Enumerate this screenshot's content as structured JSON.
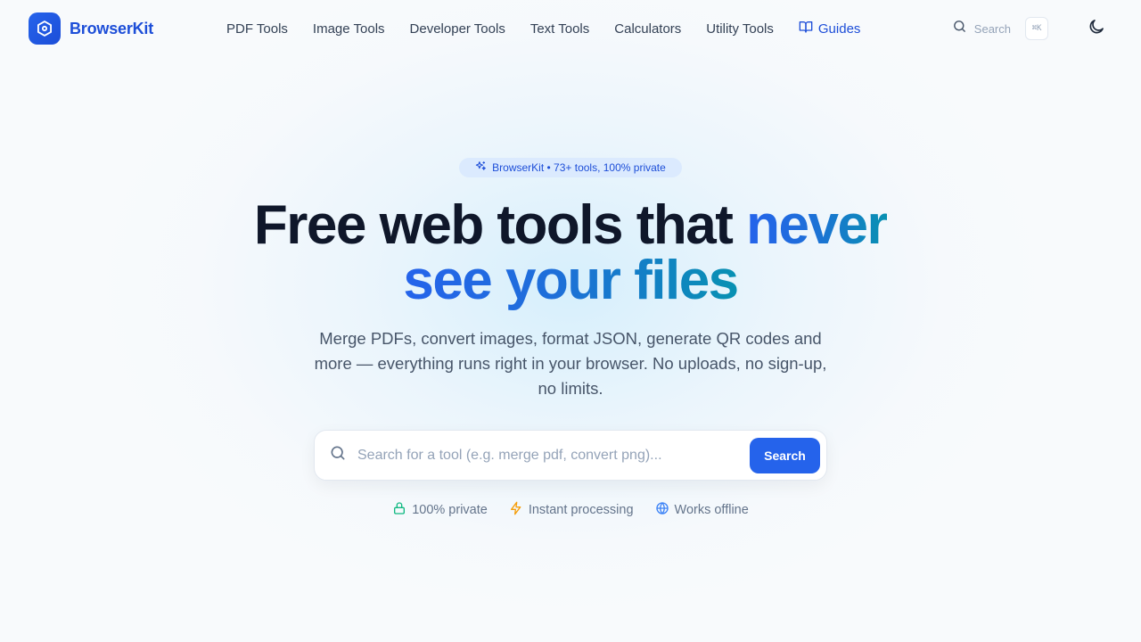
{
  "brand": {
    "name": "BrowserKit",
    "icon": "hexagon-shield-icon"
  },
  "nav": {
    "items": [
      {
        "label": "PDF Tools"
      },
      {
        "label": "Image Tools"
      },
      {
        "label": "Developer Tools"
      },
      {
        "label": "Text Tools"
      },
      {
        "label": "Calculators"
      },
      {
        "label": "Utility Tools"
      }
    ],
    "guides_label": "Guides",
    "guides_icon": "book-open-icon"
  },
  "header": {
    "search_label": "Search",
    "shortcut": "⌘K",
    "theme_icon": "moon-icon"
  },
  "hero": {
    "badge": "BrowserKit • 73+ tools, 100% private",
    "headline_dark": "Free web tools that ",
    "headline_accent_1": "never",
    "headline_accent_2": "see your files",
    "subtitle": "Merge PDFs, convert images, format JSON, generate QR codes and more — everything runs right in your browser. No uploads, no sign-up, no limits.",
    "search_placeholder": "Search for a tool (e.g. merge pdf, convert png)...",
    "search_button": "Search"
  },
  "features": [
    {
      "label": "100% private",
      "icon": "lock-icon",
      "color": "#10b981"
    },
    {
      "label": "Instant processing",
      "icon": "lightning-icon",
      "color": "#f59e0b"
    },
    {
      "label": "Works offline",
      "icon": "globe-icon",
      "color": "#3b82f6"
    }
  ],
  "colors": {
    "primary": "#2563eb",
    "accent_end": "#0891b2",
    "text_dark": "#0f172a",
    "text_muted": "#64748b"
  }
}
